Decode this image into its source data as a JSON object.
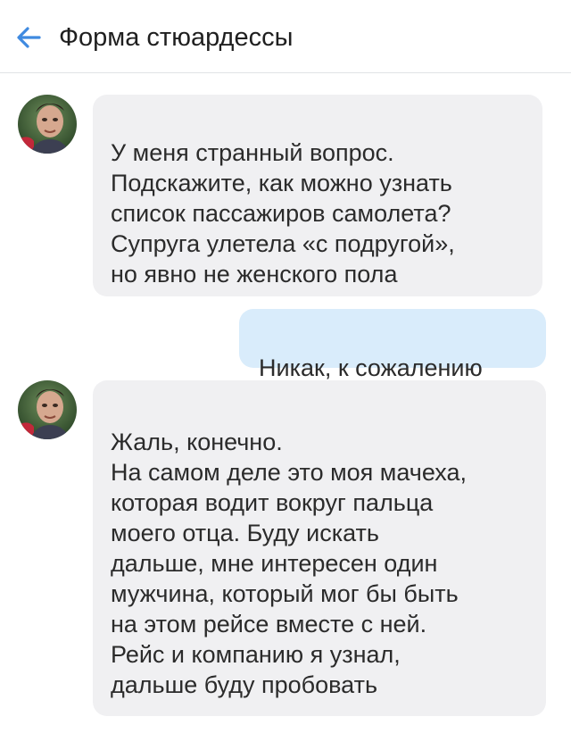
{
  "header": {
    "back_icon": "arrow-left-icon",
    "title": "Форма стюардессы",
    "accent_color": "#3f8ae0"
  },
  "messages": [
    {
      "side": "incoming",
      "avatar_icon": "user-avatar",
      "text": "У меня странный вопрос.\nПодскажите, как можно узнать\nсписок пассажиров самолета?\nСупруга улетела «с подругой»,\nно явно не женского пола"
    },
    {
      "side": "outgoing",
      "text": "Никак, к сожалению"
    },
    {
      "side": "incoming",
      "avatar_icon": "user-avatar",
      "text": "Жаль, конечно.\nНа самом деле это моя мачеха,\nкоторая водит вокруг пальца\nмоего отца. Буду искать\nдальше, мне интересен один\nмужчина, который мог бы быть\nна этом рейсе вместе с ней.\nРейс и компанию я узнал,\nдальше буду пробовать"
    }
  ],
  "colors": {
    "incoming_bubble": "#f0f0f2",
    "outgoing_bubble": "#d9ecfb",
    "divider": "#e1e3e6"
  }
}
